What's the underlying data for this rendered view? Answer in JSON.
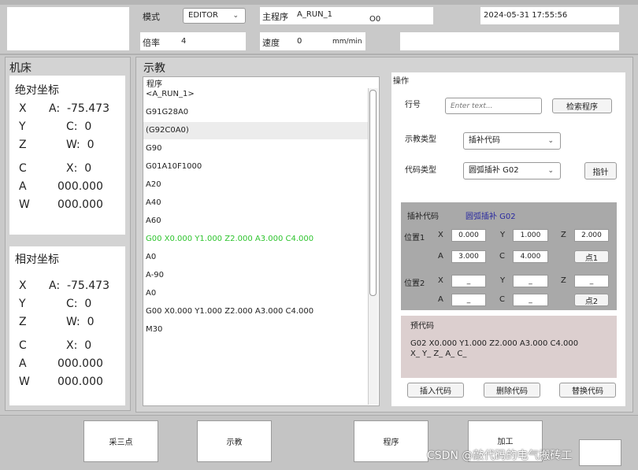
{
  "header": {
    "mode_label": "模式",
    "mode_value": "EDITOR",
    "main_prog_label": "主程序",
    "main_prog_value": "A_RUN_1",
    "prog_number": "O0",
    "datetime": "2024-05-31 17:55:56",
    "rate_label": "倍率",
    "rate_value": "4",
    "speed_label": "速度",
    "speed_value": "0",
    "speed_unit": "mm/min"
  },
  "machine": {
    "title": "机床",
    "absolute": {
      "title": "绝对坐标",
      "rows": [
        {
          "l": "X",
          "r": "A:  -75.473"
        },
        {
          "l": "Y",
          "r": "C:  0"
        },
        {
          "l": "Z",
          "r": "W:  0"
        },
        {
          "l": "C",
          "r": "X:  0"
        },
        {
          "l": "A",
          "r": "000.000"
        },
        {
          "l": "W",
          "r": "000.000"
        }
      ]
    },
    "relative": {
      "title": "相对坐标",
      "rows": [
        {
          "l": "X",
          "r": "A:  -75.473"
        },
        {
          "l": "Y",
          "r": "C:  0"
        },
        {
          "l": "Z",
          "r": "W:  0"
        },
        {
          "l": "C",
          "r": "X:  0"
        },
        {
          "l": "A",
          "r": "000.000"
        },
        {
          "l": "W",
          "r": "000.000"
        }
      ]
    }
  },
  "teach": {
    "title": "示教",
    "program_label": "程序",
    "lines": [
      "<A_RUN_1>",
      "G91G28A0",
      "(G92C0A0)",
      "G90",
      "G01A10F1000",
      "A20",
      "A40",
      "A60",
      "G00 X0.000 Y1.000 Z2.000 A3.000 C4.000",
      "A0",
      "A-90",
      "A0",
      "G00 X0.000 Y1.000 Z2.000 A3.000 C4.000",
      "M30"
    ],
    "highlight_color": "#2ec42e",
    "selected_bg": "#ececec"
  },
  "ops": {
    "title": "操作",
    "line_label": "行号",
    "line_placeholder": "Enter text...",
    "search_btn": "检索程序",
    "teach_type_label": "示教类型",
    "teach_type_value": "插补代码",
    "code_type_label": "代码类型",
    "code_type_value": "圆弧插补 G02",
    "pointer_btn": "指针",
    "interp_label": "插补代码",
    "interp_value": "圆弧插补 G02",
    "pos1_label": "位置1",
    "pos2_label": "位置2",
    "axis_x": "X",
    "axis_y": "Y",
    "axis_z": "Z",
    "axis_a": "A",
    "axis_c": "C",
    "pos1": {
      "x": "0.000",
      "y": "1.000",
      "z": "2.000",
      "a": "3.000",
      "c": "4.000"
    },
    "pos2": {
      "x": "_",
      "y": "_",
      "z": "_",
      "a": "_",
      "c": "_"
    },
    "point1_btn": "点1",
    "point2_btn": "点2",
    "pre_label": "预代码",
    "pre_line1": "G02 X0.000 Y1.000 Z2.000 A3.000 C4.000",
    "pre_line2": "X_ Y_ Z_ A_ C_",
    "insert_btn": "插入代码",
    "delete_btn": "删除代码",
    "replace_btn": "替换代码"
  },
  "bottom": {
    "btn1": "采三点",
    "btn2": "示教",
    "btn3": "程序",
    "btn4": "加工",
    "watermark": "CSDN @敲代码的电气搬砖工"
  }
}
